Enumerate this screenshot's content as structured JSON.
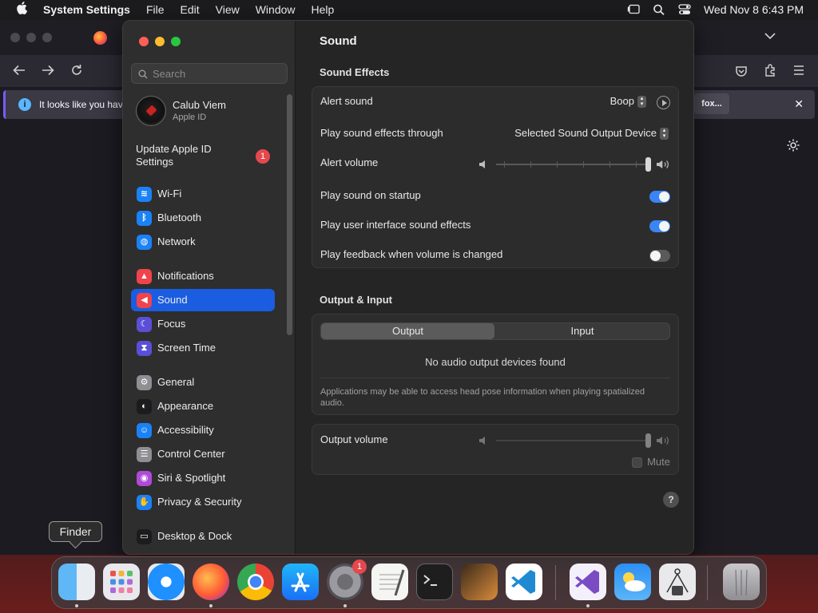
{
  "menubar": {
    "app_name": "System Settings",
    "menus": [
      "File",
      "Edit",
      "View",
      "Window",
      "Help"
    ],
    "clock": "Wed Nov 8  6:43 PM"
  },
  "browser": {
    "notification_text": "It looks like you have",
    "notification_button": "fox...",
    "close_glyph": "✕"
  },
  "sidebar": {
    "search_placeholder": "Search",
    "account": {
      "name": "Calub Viem",
      "subtitle": "Apple ID"
    },
    "update": {
      "label": "Update Apple ID Settings",
      "badge": "1"
    },
    "items": [
      {
        "label": "Wi-Fi",
        "icon": "wifi-icon",
        "color": "#1a82f7",
        "glyph": "≋"
      },
      {
        "label": "Bluetooth",
        "icon": "bluetooth-icon",
        "color": "#1a82f7",
        "glyph": "ᛒ"
      },
      {
        "label": "Network",
        "icon": "globe-icon",
        "color": "#1a82f7",
        "glyph": "◍"
      },
      {
        "label": "Notifications",
        "icon": "bell-icon",
        "color": "#f0434c",
        "glyph": "▲"
      },
      {
        "label": "Sound",
        "icon": "speaker-icon",
        "color": "#f0434c",
        "glyph": "◀"
      },
      {
        "label": "Focus",
        "icon": "moon-icon",
        "color": "#5a4fd6",
        "glyph": "☾"
      },
      {
        "label": "Screen Time",
        "icon": "hourglass-icon",
        "color": "#5a4fd6",
        "glyph": "⧗"
      },
      {
        "label": "General",
        "icon": "gear-icon",
        "color": "#8e8e93",
        "glyph": "⚙"
      },
      {
        "label": "Appearance",
        "icon": "appearance-icon",
        "color": "#1c1c1e",
        "glyph": "◐"
      },
      {
        "label": "Accessibility",
        "icon": "accessibility-icon",
        "color": "#1a82f7",
        "glyph": "☺"
      },
      {
        "label": "Control Center",
        "icon": "control-center-icon",
        "color": "#8e8e93",
        "glyph": "☰"
      },
      {
        "label": "Siri & Spotlight",
        "icon": "siri-icon",
        "color": "#b04ad8",
        "glyph": "◉"
      },
      {
        "label": "Privacy & Security",
        "icon": "hand-icon",
        "color": "#1a82f7",
        "glyph": "✋"
      },
      {
        "label": "Desktop & Dock",
        "icon": "dock-icon",
        "color": "#1c1c1e",
        "glyph": "▭"
      }
    ]
  },
  "main": {
    "title": "Sound",
    "sound_effects": {
      "heading": "Sound Effects",
      "alert_sound_label": "Alert sound",
      "alert_sound_value": "Boop",
      "play_through_label": "Play sound effects through",
      "play_through_value": "Selected Sound Output Device",
      "alert_volume_label": "Alert volume",
      "alert_volume_level": 1.0,
      "startup_label": "Play sound on startup",
      "startup_on": true,
      "ui_sounds_label": "Play user interface sound effects",
      "ui_sounds_on": true,
      "feedback_label": "Play feedback when volume is changed",
      "feedback_on": false
    },
    "output_input": {
      "heading": "Output & Input",
      "tabs": [
        "Output",
        "Input"
      ],
      "selected_tab": "Output",
      "empty_message": "No audio output devices found",
      "note": "Applications may be able to access head pose information when playing spatialized audio."
    },
    "output_volume": {
      "label": "Output volume",
      "level": 1.0,
      "mute_label": "Mute"
    },
    "help_glyph": "?"
  },
  "tooltip": {
    "text": "Finder"
  },
  "dock": {
    "apps": [
      {
        "name": "finder-icon",
        "badge": "",
        "running": true
      },
      {
        "name": "launchpad-icon",
        "badge": "",
        "running": false
      },
      {
        "name": "safari-icon",
        "badge": "",
        "running": false
      },
      {
        "name": "firefox-icon",
        "badge": "",
        "running": true
      },
      {
        "name": "chrome-icon",
        "badge": "",
        "running": false
      },
      {
        "name": "app-store-icon",
        "badge": "",
        "running": false
      },
      {
        "name": "system-settings-icon",
        "badge": "1",
        "running": true
      },
      {
        "name": "textedit-icon",
        "badge": "",
        "running": false
      },
      {
        "name": "terminal-icon",
        "badge": "",
        "running": false
      },
      {
        "name": "garageband-icon",
        "badge": "",
        "running": false
      },
      {
        "name": "vscode-icon",
        "badge": "",
        "running": false
      },
      {
        "name": "visual-studio-icon",
        "badge": "",
        "running": true
      },
      {
        "name": "weather-icon",
        "badge": "",
        "running": false
      },
      {
        "name": "archive-utility-icon",
        "badge": "",
        "running": false
      },
      {
        "name": "trash-icon",
        "badge": "",
        "running": false
      }
    ]
  }
}
